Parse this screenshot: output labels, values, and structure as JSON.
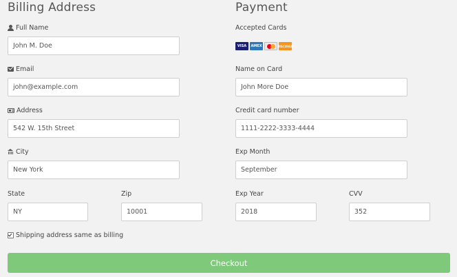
{
  "billing": {
    "title": "Billing Address",
    "full_name": {
      "label": "Full Name",
      "value": "John M. Doe",
      "icon": "user-icon"
    },
    "email": {
      "label": "Email",
      "value": "john@example.com",
      "icon": "envelope-icon"
    },
    "address": {
      "label": "Address",
      "value": "542 W. 15th Street",
      "icon": "address-card-icon"
    },
    "city": {
      "label": "City",
      "value": "New York",
      "icon": "institution-icon"
    },
    "state": {
      "label": "State",
      "value": "NY"
    },
    "zip": {
      "label": "Zip",
      "value": "10001"
    }
  },
  "payment": {
    "title": "Payment",
    "accepted_cards_label": "Accepted Cards",
    "cards": [
      {
        "name": "visa-icon",
        "text": "VISA"
      },
      {
        "name": "amex-icon",
        "text": "AMEX"
      },
      {
        "name": "mastercard-icon",
        "text": ""
      },
      {
        "name": "discover-icon",
        "text": "DISCOVER"
      }
    ],
    "name_on_card": {
      "label": "Name on Card",
      "value": "John More Doe"
    },
    "card_number": {
      "label": "Credit card number",
      "value": "1111-2222-3333-4444"
    },
    "exp_month": {
      "label": "Exp Month",
      "value": "September"
    },
    "exp_year": {
      "label": "Exp Year",
      "value": "2018"
    },
    "cvv": {
      "label": "CVV",
      "value": "352"
    }
  },
  "shipping_same": {
    "label": "Shipping address same as billing",
    "checked": true
  },
  "checkout_label": "Checkout",
  "colors": {
    "background": "#f2f2f2",
    "button": "#7ec97a"
  }
}
